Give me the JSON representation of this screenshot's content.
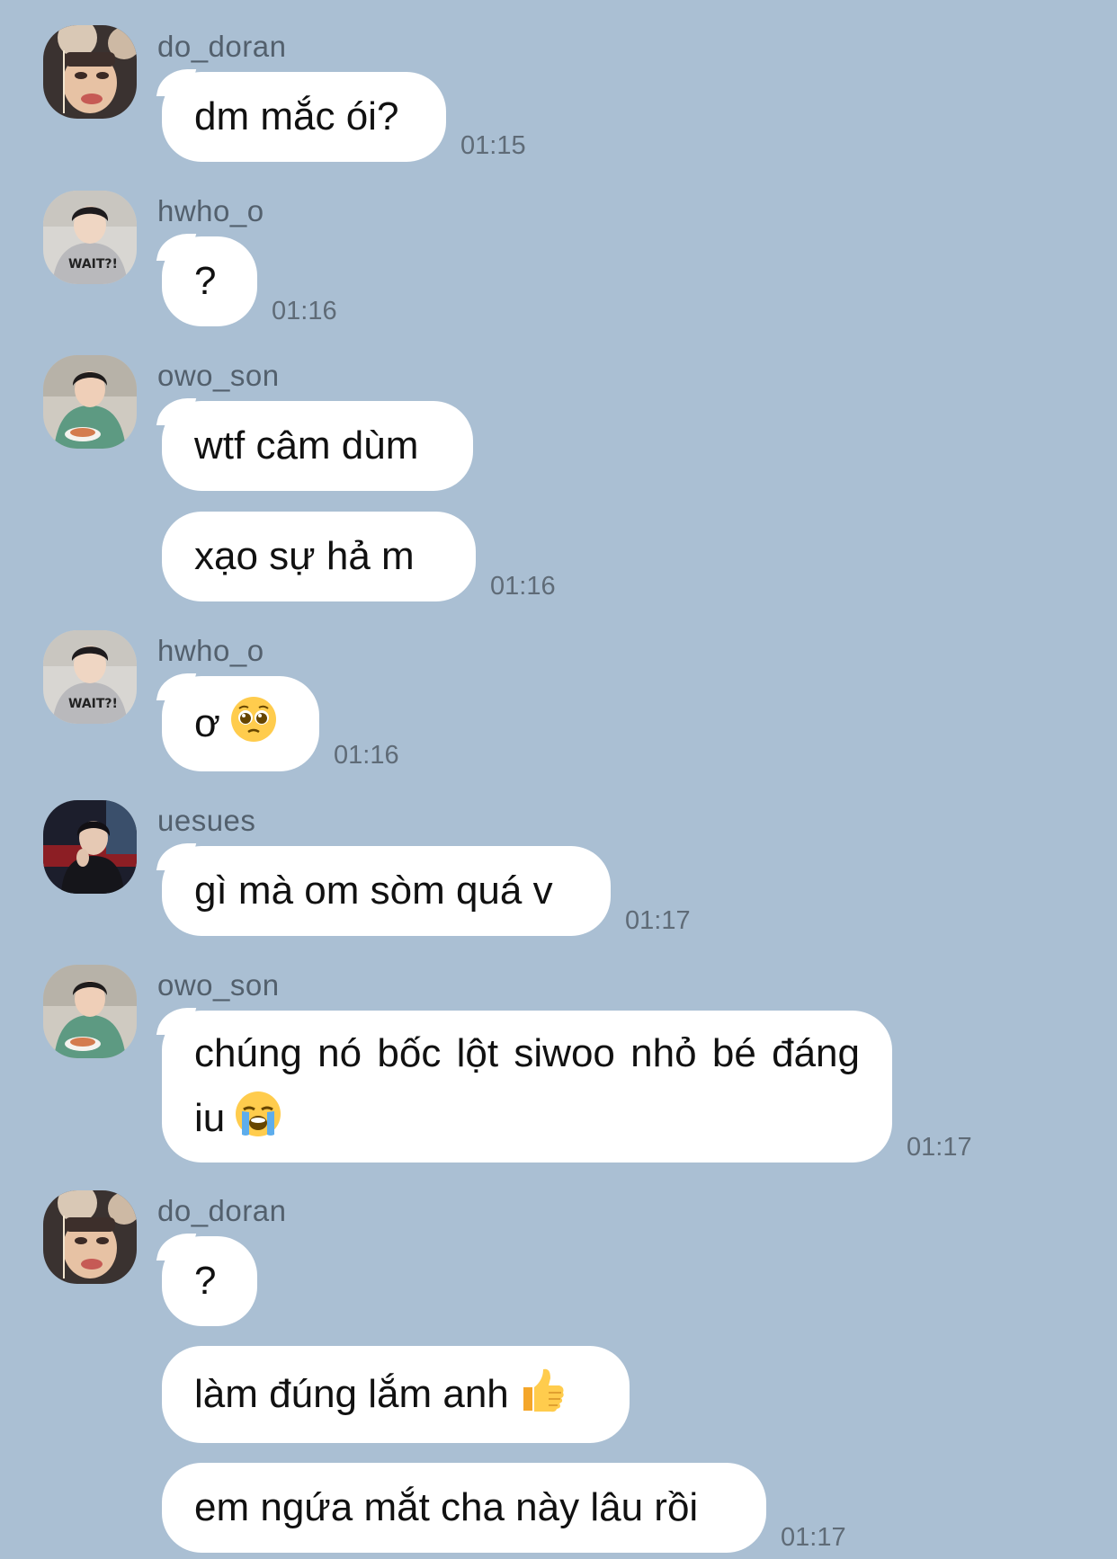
{
  "messages": [
    {
      "sender": "do_doran",
      "texts": [
        "dm mắc ói?"
      ],
      "time": "01:15"
    },
    {
      "sender": "hwho_o",
      "texts": [
        "?"
      ],
      "time": "01:16"
    },
    {
      "sender": "owo_son",
      "texts": [
        "wtf câm dùm",
        "xạo sự hả m"
      ],
      "time": "01:16"
    },
    {
      "sender": "hwho_o",
      "texts": [
        "ơ"
      ],
      "emoji": "pleading-face-emoji",
      "time": "01:16"
    },
    {
      "sender": "uesues",
      "texts": [
        "gì mà om sòm quá v"
      ],
      "time": "01:17"
    },
    {
      "sender": "owo_son",
      "texts": [
        "chúng nó bốc lột siwoo nhỏ bé đáng iu"
      ],
      "emoji": "loudly-crying-face-emoji",
      "time": "01:17"
    },
    {
      "sender": "do_doran",
      "texts": [
        "?",
        "làm đúng lắm anh",
        "em ngứa mắt cha này lâu rồi"
      ],
      "emoji_on_second": "thumbs-up-emoji",
      "time": "01:17"
    }
  ],
  "colors": {
    "background": "#aabfd3",
    "bubble": "#ffffff",
    "sender_text": "#53606d",
    "time_text": "#5f6b77"
  }
}
